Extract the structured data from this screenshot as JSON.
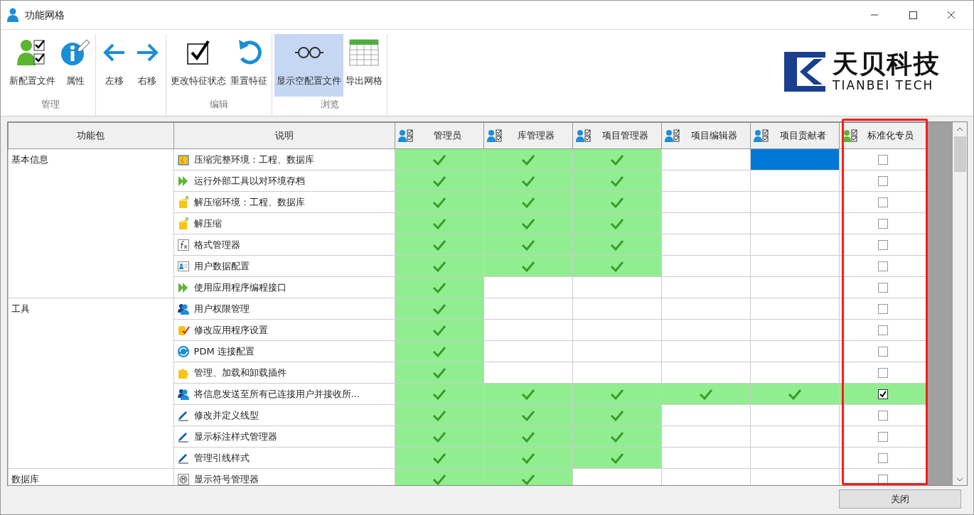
{
  "window": {
    "title": "功能网格"
  },
  "toolbar": {
    "groups": [
      {
        "label": "管理",
        "buttons": [
          {
            "kind": "new-profile",
            "label": "新配置文件",
            "selected": false
          },
          {
            "kind": "properties",
            "label": "属性",
            "selected": false
          }
        ]
      },
      {
        "buttons": [
          {
            "kind": "left",
            "label": "左移",
            "selected": false
          },
          {
            "kind": "right",
            "label": "右移",
            "selected": false
          }
        ]
      },
      {
        "label": "编辑",
        "buttons": [
          {
            "kind": "check",
            "label": "更改特征状态",
            "selected": false
          },
          {
            "kind": "reset",
            "label": "重置特征",
            "selected": false
          }
        ]
      },
      {
        "label": "浏览",
        "buttons": [
          {
            "kind": "glasses",
            "label": "显示空配置文件",
            "selected": true
          },
          {
            "kind": "grid",
            "label": "导出网格",
            "selected": false
          }
        ]
      }
    ]
  },
  "logo": {
    "name": "天贝科技",
    "subtitle": "TIANBEI TECH"
  },
  "table": {
    "columns": [
      "功能包",
      "说明"
    ],
    "roles": [
      {
        "label": "管理员",
        "color": "#1a8fd6"
      },
      {
        "label": "库管理器",
        "color": "#1a8fd6"
      },
      {
        "label": "项目管理器",
        "color": "#1a8fd6"
      },
      {
        "label": "项目编辑器",
        "color": "#1a8fd6"
      },
      {
        "label": "项目贡献者",
        "color": "#1a8fd6"
      },
      {
        "label": "标准化专员",
        "color": "#5cb531"
      }
    ],
    "groups": [
      {
        "name": "基本信息",
        "rows": [
          {
            "kind": "archive",
            "text": "压缩完整环境：工程、数据库",
            "roles": [
              {
                "granted": true,
                "selected": false
              },
              {
                "granted": true,
                "selected": false
              },
              {
                "granted": true,
                "selected": false
              },
              {
                "granted": false,
                "selected": false
              },
              {
                "granted": false,
                "selected": true
              },
              {
                "checked": false
              }
            ]
          },
          {
            "kind": "run",
            "text": "运行外部工具以对环境存档",
            "roles": [
              {
                "granted": true,
                "selected": false
              },
              {
                "granted": true,
                "selected": false
              },
              {
                "granted": true,
                "selected": false
              },
              {
                "granted": false,
                "selected": false
              },
              {
                "granted": false,
                "selected": false
              },
              {
                "checked": false
              }
            ]
          },
          {
            "kind": "extract",
            "text": "解压缩环境：工程、数据库",
            "roles": [
              {
                "granted": true,
                "selected": false
              },
              {
                "granted": true,
                "selected": false
              },
              {
                "granted": true,
                "selected": false
              },
              {
                "granted": false,
                "selected": false
              },
              {
                "granted": false,
                "selected": false
              },
              {
                "checked": false
              }
            ]
          },
          {
            "kind": "extract",
            "text": "解压缩",
            "roles": [
              {
                "granted": true,
                "selected": false
              },
              {
                "granted": true,
                "selected": false
              },
              {
                "granted": true,
                "selected": false
              },
              {
                "granted": false,
                "selected": false
              },
              {
                "granted": false,
                "selected": false
              },
              {
                "checked": false
              }
            ]
          },
          {
            "kind": "formula",
            "text": "格式管理器",
            "roles": [
              {
                "granted": true,
                "selected": false
              },
              {
                "granted": true,
                "selected": false
              },
              {
                "granted": true,
                "selected": false
              },
              {
                "granted": false,
                "selected": false
              },
              {
                "granted": false,
                "selected": false
              },
              {
                "checked": false
              }
            ]
          },
          {
            "kind": "user-card",
            "text": "用户数据配置",
            "roles": [
              {
                "granted": true,
                "selected": false
              },
              {
                "granted": true,
                "selected": false
              },
              {
                "granted": true,
                "selected": false
              },
              {
                "granted": false,
                "selected": false
              },
              {
                "granted": false,
                "selected": false
              },
              {
                "checked": false
              }
            ]
          },
          {
            "kind": "run",
            "text": "使用应用程序编程接口",
            "roles": [
              {
                "granted": true,
                "selected": false
              },
              {
                "granted": false,
                "selected": false
              },
              {
                "granted": false,
                "selected": false
              },
              {
                "granted": false,
                "selected": false
              },
              {
                "granted": false,
                "selected": false
              },
              {
                "checked": false
              }
            ]
          }
        ]
      },
      {
        "name": "工具",
        "rows": [
          {
            "kind": "users",
            "text": "用户权限管理",
            "roles": [
              {
                "granted": true,
                "selected": false
              },
              {
                "granted": false,
                "selected": false
              },
              {
                "granted": false,
                "selected": false
              },
              {
                "granted": false,
                "selected": false
              },
              {
                "granted": false,
                "selected": false
              },
              {
                "checked": false
              }
            ]
          },
          {
            "kind": "settings",
            "text": "修改应用程序设置",
            "roles": [
              {
                "granted": true,
                "selected": false
              },
              {
                "granted": false,
                "selected": false
              },
              {
                "granted": false,
                "selected": false
              },
              {
                "granted": false,
                "selected": false
              },
              {
                "granted": false,
                "selected": false
              },
              {
                "checked": false
              }
            ]
          },
          {
            "kind": "pdm",
            "text": "PDM 连接配置",
            "roles": [
              {
                "granted": true,
                "selected": false
              },
              {
                "granted": false,
                "selected": false
              },
              {
                "granted": false,
                "selected": false
              },
              {
                "granted": false,
                "selected": false
              },
              {
                "granted": false,
                "selected": false
              },
              {
                "checked": false
              }
            ]
          },
          {
            "kind": "plugin",
            "text": "管理、加载和卸载插件",
            "roles": [
              {
                "granted": true,
                "selected": false
              },
              {
                "granted": false,
                "selected": false
              },
              {
                "granted": false,
                "selected": false
              },
              {
                "granted": false,
                "selected": false
              },
              {
                "granted": false,
                "selected": false
              },
              {
                "checked": false
              }
            ]
          },
          {
            "kind": "users",
            "text": "将信息发送至所有已连接用户并接收所...",
            "roles": [
              {
                "granted": true,
                "selected": false
              },
              {
                "granted": true,
                "selected": false
              },
              {
                "granted": true,
                "selected": false
              },
              {
                "granted": true,
                "selected": false
              },
              {
                "granted": true,
                "selected": false
              },
              {
                "checked": true
              }
            ]
          },
          {
            "kind": "pen",
            "text": "修改并定义线型",
            "roles": [
              {
                "granted": true,
                "selected": false
              },
              {
                "granted": true,
                "selected": false
              },
              {
                "granted": true,
                "selected": false
              },
              {
                "granted": false,
                "selected": false
              },
              {
                "granted": false,
                "selected": false
              },
              {
                "checked": false
              }
            ]
          },
          {
            "kind": "pen",
            "text": "显示标注样式管理器",
            "roles": [
              {
                "granted": true,
                "selected": false
              },
              {
                "granted": true,
                "selected": false
              },
              {
                "granted": true,
                "selected": false
              },
              {
                "granted": false,
                "selected": false
              },
              {
                "granted": false,
                "selected": false
              },
              {
                "checked": false
              }
            ]
          },
          {
            "kind": "pen",
            "text": "管理引线样式",
            "roles": [
              {
                "granted": true,
                "selected": false
              },
              {
                "granted": true,
                "selected": false
              },
              {
                "granted": true,
                "selected": false
              },
              {
                "granted": false,
                "selected": false
              },
              {
                "granted": false,
                "selected": false
              },
              {
                "checked": false
              }
            ]
          }
        ]
      },
      {
        "name": "数据库",
        "rows": [
          {
            "kind": "symbol",
            "text": "显示符号管理器",
            "roles": [
              {
                "granted": true,
                "selected": false
              },
              {
                "granted": true,
                "selected": false
              },
              {
                "granted": false,
                "selected": false
              },
              {
                "granted": false,
                "selected": false
              },
              {
                "granted": false,
                "selected": false
              },
              {
                "checked": false
              }
            ]
          }
        ]
      }
    ]
  },
  "footer": {
    "button": "关闭"
  }
}
